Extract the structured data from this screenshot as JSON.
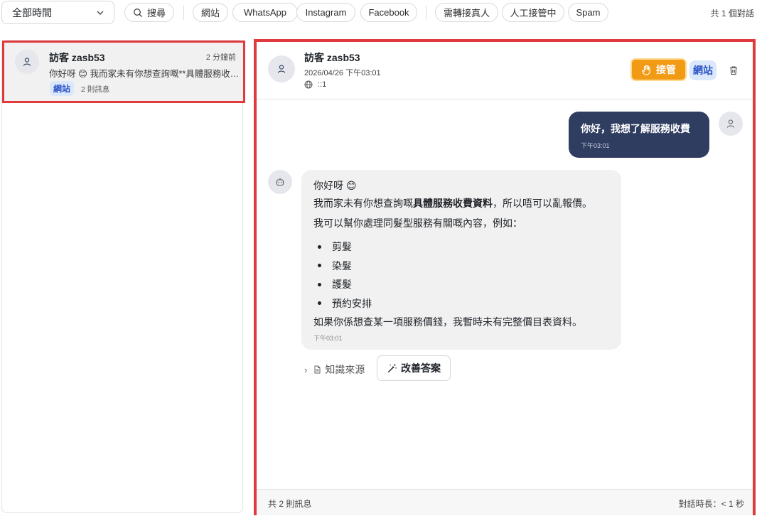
{
  "filters": {
    "time_select": "全部時間",
    "search_label": "搜尋",
    "channels": [
      "網站",
      "WhatsApp",
      "Instagram",
      "Facebook"
    ],
    "status": [
      "需轉接真人",
      "人工接管中",
      "Spam"
    ],
    "total": "共 1 個對話"
  },
  "conversation_list": [
    {
      "name": "訪客 zasb53",
      "time": "2 分鐘前",
      "preview": "你好呀 😊 我而家未有你想查詢嘅**具體服務收費資料**",
      "badge": "網站",
      "count": "2 則訊息"
    }
  ],
  "chat": {
    "header": {
      "name": "訪客 zasb53",
      "date": "2026/04/26 下午03:01",
      "ip": "::1",
      "takeover_label": "接管",
      "badge": "網站"
    },
    "user_message": {
      "text": "你好，我想了解服務收費",
      "time": "下午03:01"
    },
    "bot_message": {
      "greeting": "你好呀 😊",
      "line1_before": "我而家未有你想查詢嘅",
      "line1_bold": "具體服務收費資料",
      "line1_after": "，所以唔可以亂報價。",
      "line2": "我可以幫你處理同髮型服務有關嘅內容，例如：",
      "items": [
        "剪髮",
        "染髮",
        "護髮",
        "預約安排"
      ],
      "line3": "如果你係想查某一項服務價錢，我暫時未有完整價目表資料。",
      "time": "下午03:01"
    },
    "source_label": "知識來源",
    "improve_label": "改善答案",
    "footer": {
      "message_count": "共 2 則訊息",
      "duration": "對話時長：< 1 秒"
    }
  },
  "colors": {
    "accent_red": "#e0393e",
    "takeover_orange": "#f19a13",
    "user_bubble": "#2f3d61",
    "badge_bg": "#dbe7fb",
    "badge_text": "#2c55c6"
  }
}
